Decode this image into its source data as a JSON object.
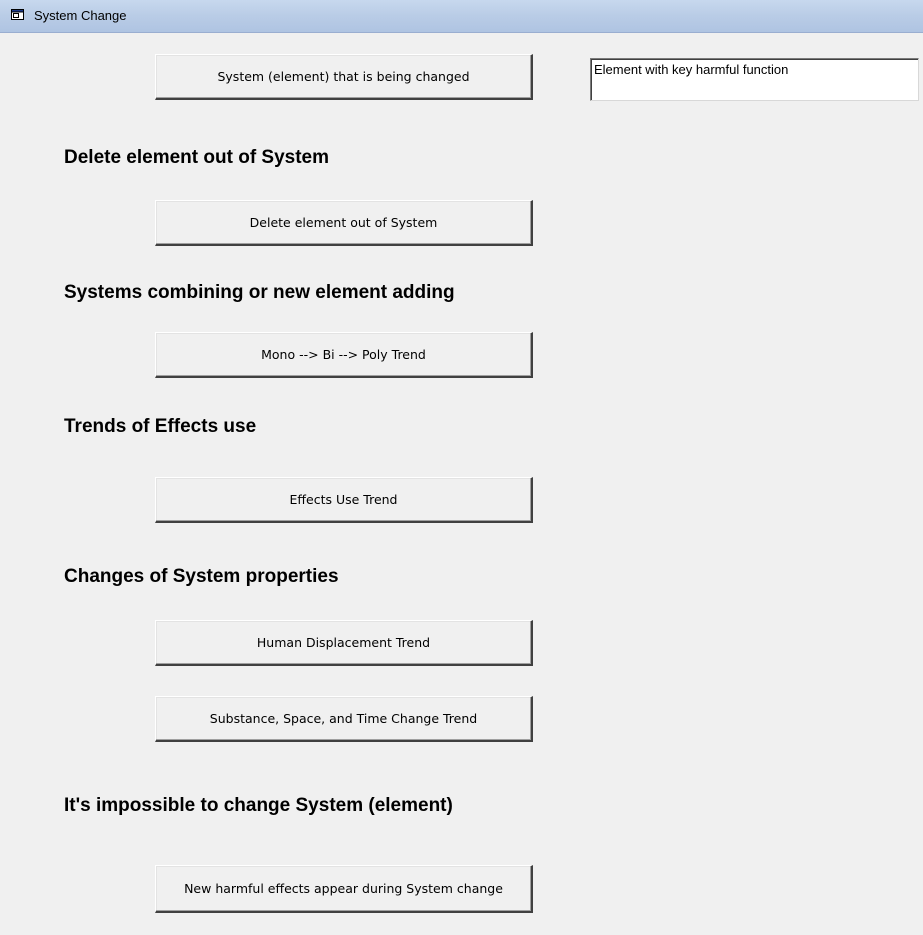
{
  "window": {
    "title": "System Change",
    "icon": "window-icon"
  },
  "main": {
    "system_button": "System (element) that is being changed",
    "key_function_field": "Element with key harmful function",
    "sections": [
      {
        "heading": "Delete element out of System",
        "buttons": [
          "Delete element out of System"
        ]
      },
      {
        "heading": "Systems combining or new element adding",
        "buttons": [
          "Mono --> Bi --> Poly Trend"
        ]
      },
      {
        "heading": "Trends of Effects use",
        "buttons": [
          "Effects Use Trend"
        ]
      },
      {
        "heading": "Changes of System properties",
        "buttons": [
          "Human Displacement Trend",
          "Substance, Space, and Time Change Trend"
        ]
      },
      {
        "heading": "It's impossible to change System (element)",
        "buttons": [
          "New harmful effects appear during System change"
        ]
      }
    ]
  },
  "colors": {
    "background": "#f0f0f0",
    "titlebar": "#b9cce6"
  }
}
